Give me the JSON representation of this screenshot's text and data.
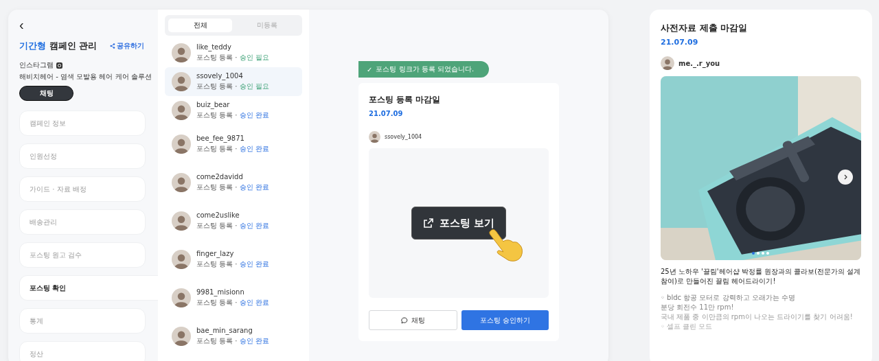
{
  "sidebar": {
    "back": "‹",
    "title_accent": "기간형",
    "title": "캠페인 관리",
    "share": "공유하기",
    "channel": "인스타그램",
    "campaign": "해비치헤어 - 염색 모발용 헤어 케어 솔루션",
    "chat_button": "채팅",
    "items": [
      {
        "label": "캠페인 정보",
        "selected": false
      },
      {
        "label": "인원선정",
        "selected": false
      },
      {
        "label": "가이드 · 자료 배정",
        "selected": false
      },
      {
        "label": "배송관리",
        "selected": false
      },
      {
        "label": "포스팅 원고 검수",
        "selected": false
      },
      {
        "label": "포스팅 확인",
        "selected": true
      },
      {
        "label": "통계",
        "selected": false
      },
      {
        "label": "정산",
        "selected": false
      }
    ]
  },
  "list": {
    "tabs": [
      {
        "label": "전체",
        "selected": true
      },
      {
        "label": "미등록",
        "selected": false
      }
    ],
    "rows": [
      {
        "name": "like_teddy",
        "state": "포스팅 등록 ·",
        "status": "승인 필요",
        "approved": false,
        "selected": false
      },
      {
        "name": "ssovely_1004",
        "state": "포스팅 등록 ·",
        "status": "승인 필요",
        "approved": false,
        "selected": true
      },
      {
        "name": "buiz_bear",
        "state": "포스팅 등록 ·",
        "status": "승인 완료",
        "approved": true,
        "selected": false
      },
      {
        "name": "bee_fee_9871",
        "state": "포스팅 등록 ·",
        "status": "승인 완료",
        "approved": true,
        "selected": false
      },
      {
        "name": "come2davidd",
        "state": "포스팅 등록 ·",
        "status": "승인 완료",
        "approved": true,
        "selected": false
      },
      {
        "name": "come2uslike",
        "state": "포스팅 등록 ·",
        "status": "승인 완료",
        "approved": true,
        "selected": false
      },
      {
        "name": "finger_lazy",
        "state": "포스팅 등록 ·",
        "status": "승인 완료",
        "approved": true,
        "selected": false
      },
      {
        "name": "9981_misionn",
        "state": "포스팅 등록 ·",
        "status": "승인 완료",
        "approved": true,
        "selected": false
      },
      {
        "name": "bae_min_sarang",
        "state": "포스팅 등록 ·",
        "status": "승인 완료",
        "approved": true,
        "selected": false
      }
    ]
  },
  "detail": {
    "toast_icon": "✓",
    "toast": "포스팅 링크가 등록 되었습니다.",
    "title": "포스팅 등록 마감일",
    "date": "21.07.09",
    "user": "ssovely_1004",
    "view_button": "포스팅 보기",
    "chat_button": "채팅",
    "approve_button": "포스팅 승인하기"
  },
  "preview": {
    "title": "사전자료 제출 마감일",
    "date": "21.07.09",
    "user": "me._.r_you",
    "photo": {
      "kind": "picture",
      "dots": [
        {
          "selected": true
        },
        {
          "selected": false
        },
        {
          "selected": false
        },
        {
          "selected": false
        }
      ]
    },
    "paragraphs": [
      [
        "25년 노하우 '끌림'헤어샵 박정률 원장과의 콜라보(전문가의 설계 참여)로 만들어진 끌림 헤어드라이기!"
      ],
      [
        "◦ bldc 항공 모터로 강력하고 오래가는 수명",
        "분당 회전수 11만 rpm!",
        "국내 제품 중 이만큼의 rpm이 나오는 드라이기를 찾기 어려움!",
        "◦ 셀프 클린 모드"
      ]
    ]
  }
}
